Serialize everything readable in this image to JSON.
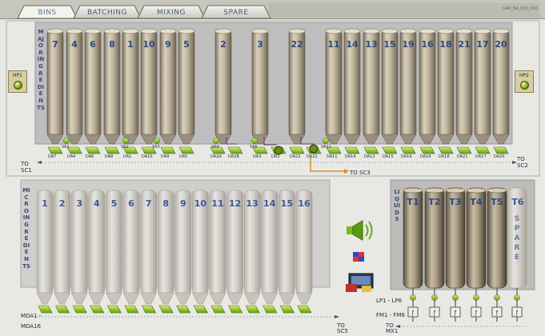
{
  "header": {
    "caption": "GRA_BA_010_010"
  },
  "tabs": [
    "BINS",
    "BATCHING",
    "MIXING",
    "SPARE"
  ],
  "active_tab": "BINS",
  "major": {
    "label": "MAJOR INGREDIENTS",
    "left_group": [
      "7",
      "4",
      "6",
      "8",
      "1",
      "10",
      "9",
      "5"
    ],
    "mid_group": [
      "2",
      "3",
      "22"
    ],
    "right_group": [
      "11",
      "14",
      "13",
      "15",
      "19",
      "16",
      "18",
      "21",
      "17",
      "20"
    ],
    "bottom_labels": [
      "DA7",
      "DA4",
      "DA6",
      "DA8",
      "DA1",
      "DA10",
      "DA9",
      "DA5",
      "DA2A",
      "DA2B",
      "DA3",
      "DR2",
      "DA22",
      "DR22",
      "DA11",
      "DA14",
      "DA13",
      "DA15",
      "DA19",
      "DA16",
      "DA18",
      "DA21",
      "DA17",
      "DA20"
    ],
    "valve_labels": [
      "VA1",
      "VA2",
      "VA3",
      "VA4",
      "VA5",
      "VA11"
    ],
    "to_left": "TO\nSC1",
    "to_right": "TO\nSC2",
    "to_mid": "TO SC3"
  },
  "hp1": "HP1",
  "hp2": "HP2",
  "micro": {
    "label": "MICRO INGREDIENTS",
    "silos": [
      "1",
      "2",
      "3",
      "4",
      "5",
      "6",
      "7",
      "8",
      "9",
      "10",
      "11",
      "12",
      "13",
      "14",
      "15",
      "16"
    ],
    "mda1": "MDA1 -",
    "mda16": "MDA16",
    "to": "TO\nSC5"
  },
  "liquids": {
    "label": "LIQUIDS",
    "tanks": [
      "T1",
      "T2",
      "T3",
      "T4",
      "T5"
    ],
    "spare_tank": "T6",
    "spare_word": "SPARE",
    "lp": "LP1 - LP6",
    "fm": "FM1 - FM6",
    "to": "TO\nMX1"
  },
  "icons": [
    "speaker-icon",
    "flag-icon",
    "computer-icon"
  ]
}
